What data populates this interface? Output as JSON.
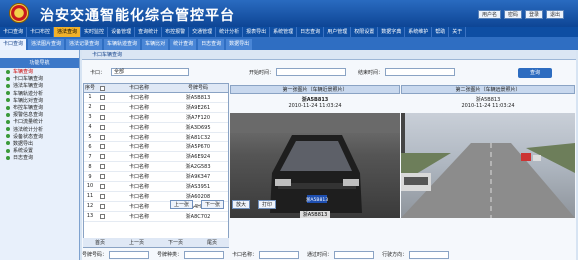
{
  "header": {
    "title": "治安交通智能化综合管控平台",
    "login": [
      "用户名",
      "密码",
      "登录",
      "退出"
    ]
  },
  "nav1": [
    "卡口查询",
    "卡口布控",
    "违法查询",
    "实时监控",
    "设备管理",
    "查询统计",
    "布控报警",
    "交通管理",
    "统计分析",
    "报表导出",
    "系统管理",
    "日志查询",
    "用户管理",
    "权限设置",
    "数据字典",
    "系统维护",
    "帮助",
    "关于"
  ],
  "nav2": [
    "卡口查询",
    "违法图片查询",
    "违法记录查询",
    "车辆轨迹查询",
    "车辆比对",
    "统计查询",
    "日志查询",
    "数据导出"
  ],
  "sidebar": {
    "header": "功能导航",
    "items": [
      "车辆查询",
      "卡口车辆查询",
      "违法车辆查询",
      "车辆轨迹分析",
      "车辆比对查询",
      "布控车辆查询",
      "报警信息查询",
      "卡口流量统计",
      "违法统计分析",
      "设备状态查询",
      "数据导出",
      "系统设置",
      "日志查询"
    ]
  },
  "main": {
    "title": "卡口车辆查询",
    "filter": {
      "label1": "卡口：",
      "val1": "全部",
      "label2": "开始时间：",
      "label3": "结束时间：",
      "button": "查询"
    },
    "table": {
      "headers": [
        "序号",
        "",
        "卡口名称",
        "号牌号码"
      ],
      "rows": [
        [
          "1",
          "卡口名称",
          "浙A5B813"
        ],
        [
          "2",
          "卡口名称",
          "浙A9E261"
        ],
        [
          "3",
          "卡口名称",
          "浙A7F120"
        ],
        [
          "4",
          "卡口名称",
          "浙A3D695"
        ],
        [
          "5",
          "卡口名称",
          "浙A81C32"
        ],
        [
          "6",
          "卡口名称",
          "浙A5P670"
        ],
        [
          "7",
          "卡口名称",
          "浙A6E924"
        ],
        [
          "8",
          "卡口名称",
          "浙A2G583"
        ],
        [
          "9",
          "卡口名称",
          "浙A9K347"
        ],
        [
          "10",
          "卡口名称",
          "浙AS3951"
        ],
        [
          "11",
          "卡口名称",
          "浙A60208"
        ],
        [
          "12",
          "卡口名称",
          "浙A4H517"
        ],
        [
          "13",
          "卡口名称",
          "浙A8C702"
        ]
      ],
      "pager": [
        "首页",
        "上一页",
        "下一页",
        "尾页"
      ]
    },
    "photos": {
      "left_header": "第一张图片（车辆近景照片）",
      "right_header": "第二张图片（车辆远景照片）",
      "left_plate": "浙A5B813",
      "left_time": "2010-11-24 11:03:24",
      "right_plate": "浙A5B813",
      "right_time": "2010-11-24 11:03:24",
      "plate_label": "浙A5B813",
      "buttons": [
        "上一张",
        "下一张",
        "放大",
        "打印"
      ]
    },
    "bottom": [
      "号牌号码：",
      "号牌种类：",
      "卡口名称：",
      "通过时间：",
      "行驶方向："
    ]
  }
}
